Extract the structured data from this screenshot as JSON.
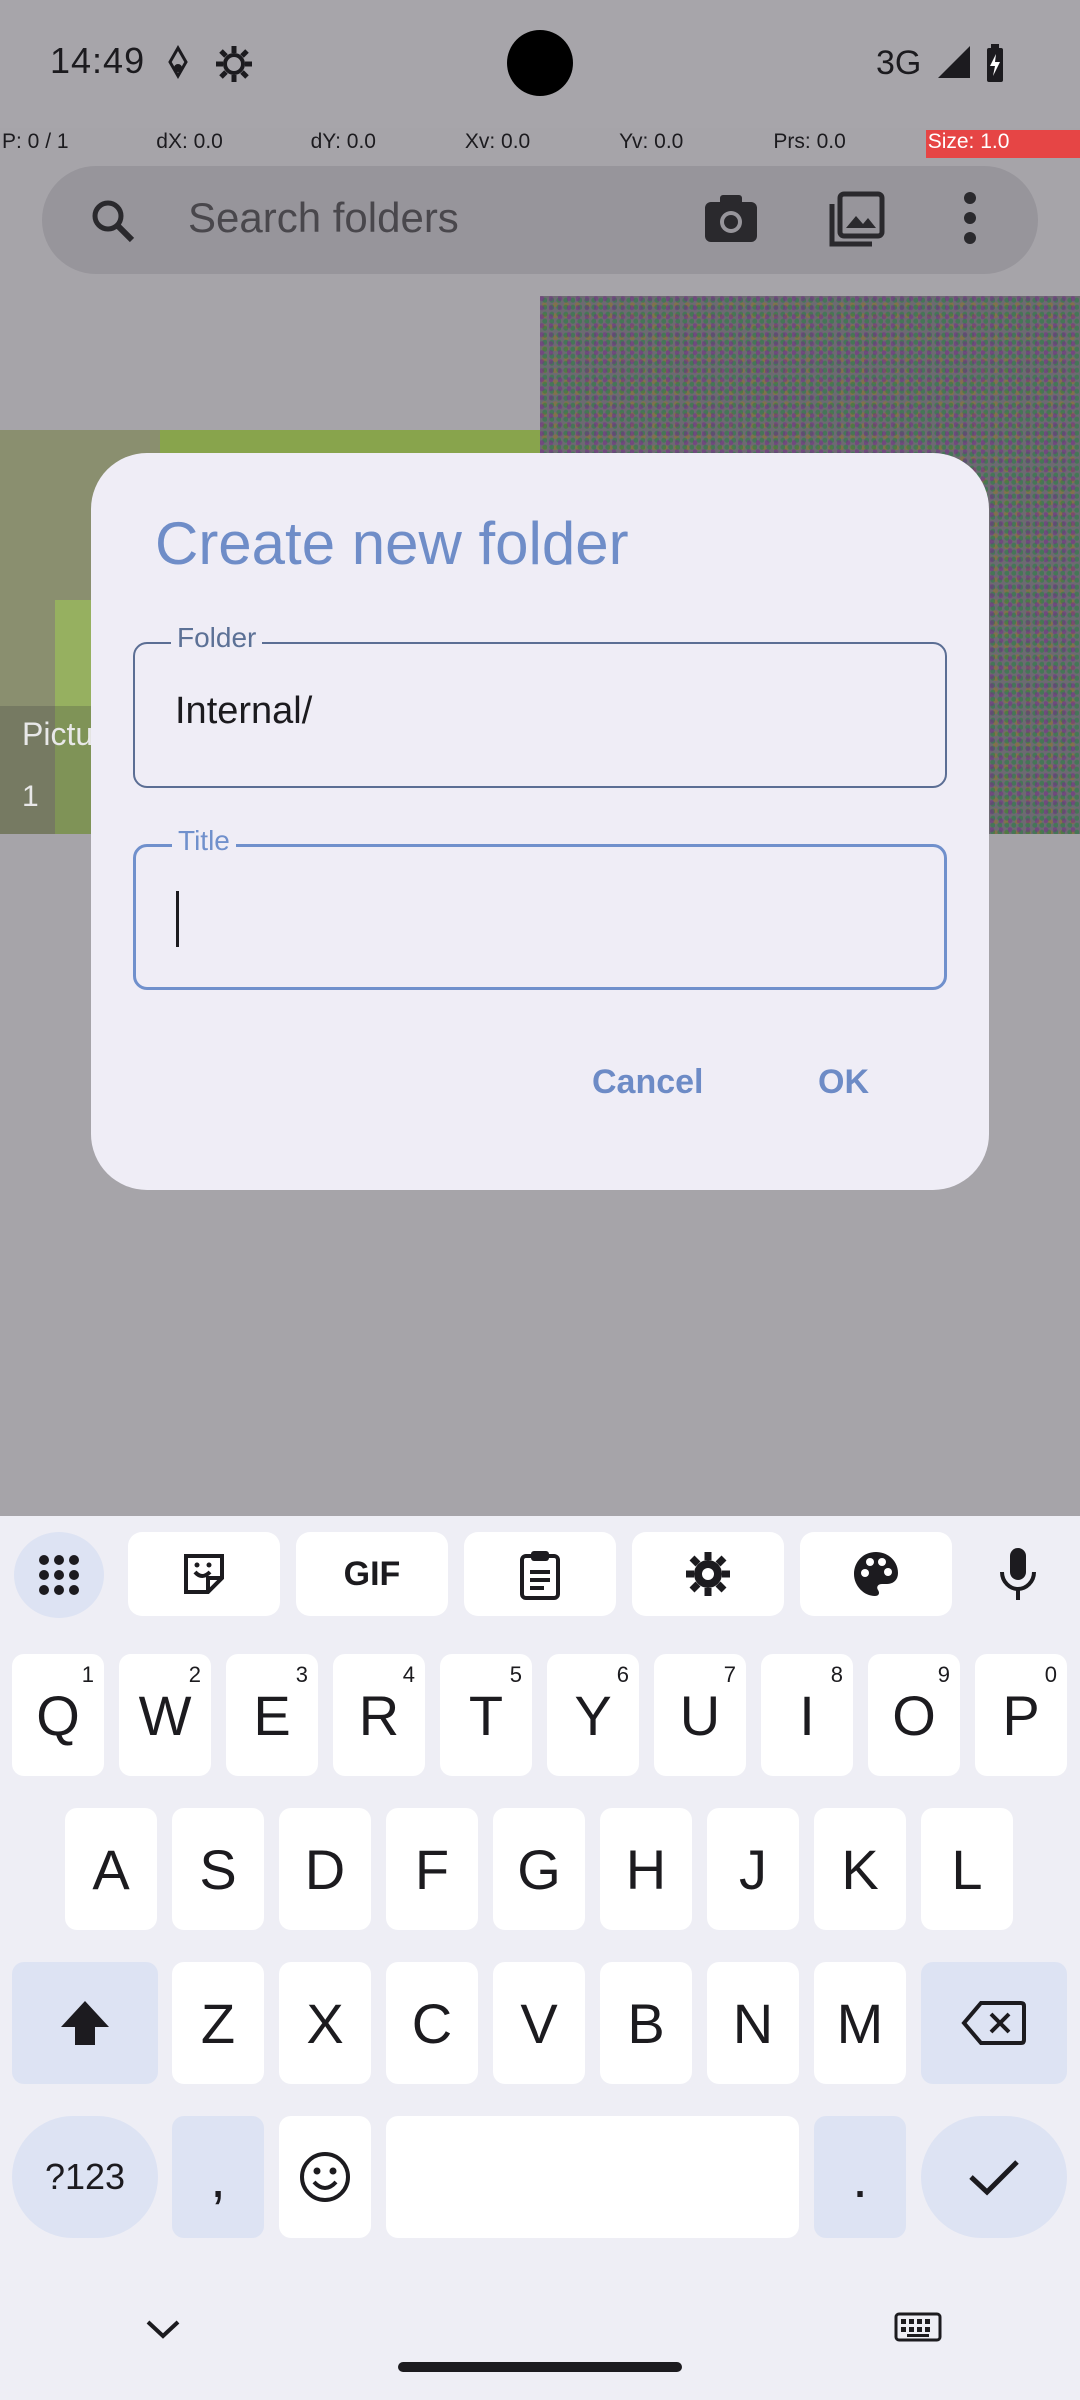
{
  "status_bar": {
    "time": "14:49",
    "network": "3G"
  },
  "debug_bar": {
    "p": "P: 0 / 1",
    "dx": "dX: 0.0",
    "dy": "dY: 0.0",
    "xv": "Xv: 0.0",
    "yv": "Yv: 0.0",
    "prs": "Prs: 0.0",
    "size": "Size: 1.0"
  },
  "background_app": {
    "search_placeholder": "Search folders",
    "tile_label": "Pictu",
    "tile_count": "1"
  },
  "dialog": {
    "title": "Create new folder",
    "folder_label": "Folder",
    "folder_value": "Internal/",
    "title_label": "Title",
    "title_value": "",
    "cancel": "Cancel",
    "ok": "OK"
  },
  "keyboard": {
    "toolbar": [
      "apps-icon",
      "sticker-icon",
      "GIF",
      "clipboard-icon",
      "settings-icon",
      "palette-icon",
      "mic-icon"
    ],
    "row1": [
      {
        "k": "Q",
        "h": "1"
      },
      {
        "k": "W",
        "h": "2"
      },
      {
        "k": "E",
        "h": "3"
      },
      {
        "k": "R",
        "h": "4"
      },
      {
        "k": "T",
        "h": "5"
      },
      {
        "k": "Y",
        "h": "6"
      },
      {
        "k": "U",
        "h": "7"
      },
      {
        "k": "I",
        "h": "8"
      },
      {
        "k": "O",
        "h": "9"
      },
      {
        "k": "P",
        "h": "0"
      }
    ],
    "row2": [
      "A",
      "S",
      "D",
      "F",
      "G",
      "H",
      "J",
      "K",
      "L"
    ],
    "row3": [
      "Z",
      "X",
      "C",
      "V",
      "B",
      "N",
      "M"
    ],
    "symbols": "?123",
    "comma": ",",
    "period": ".",
    "gif": "GIF"
  },
  "colors": {
    "accent": "#6f8dc8",
    "dialog_bg": "#efedf6",
    "scrim": "#a6a4a9"
  }
}
